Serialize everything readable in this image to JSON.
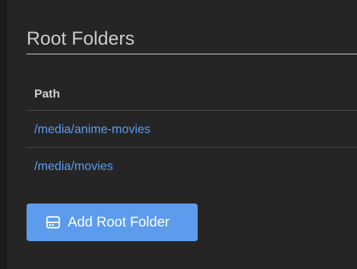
{
  "section": {
    "title": "Root Folders"
  },
  "table": {
    "columns": [
      "Path"
    ],
    "rows": [
      {
        "path": "/media/anime-movies"
      },
      {
        "path": "/media/movies"
      }
    ]
  },
  "actions": {
    "add_root_folder_label": "Add Root Folder",
    "add_root_folder_icon": "drive-icon"
  },
  "colors": {
    "background": "#252525",
    "accent": "#5d9cec",
    "link": "#5d9cec"
  }
}
